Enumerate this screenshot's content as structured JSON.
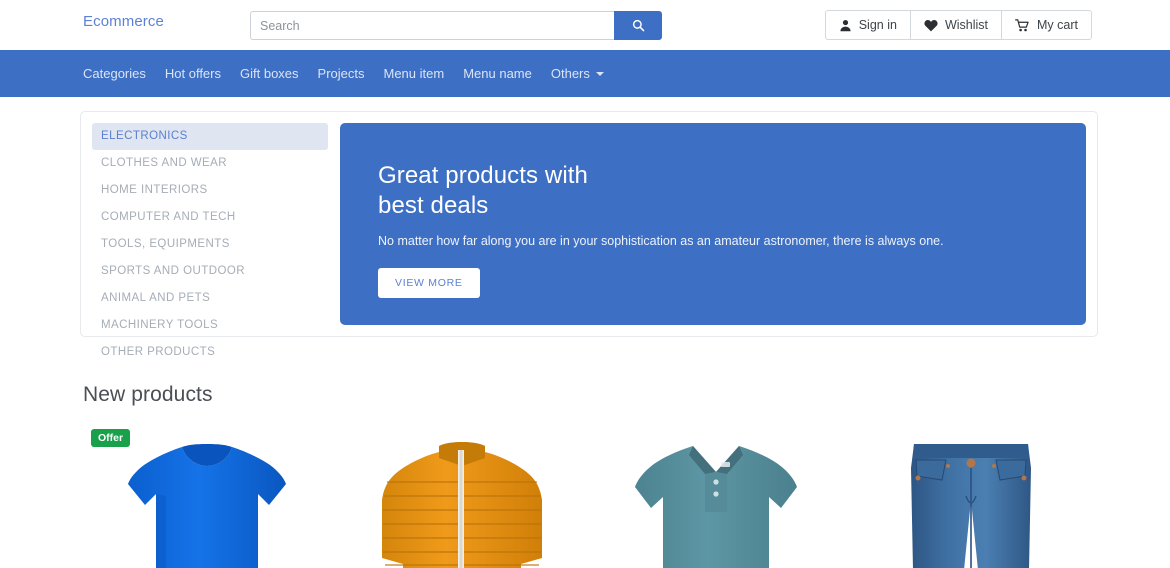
{
  "header": {
    "brand": "Ecommerce",
    "search": {
      "placeholder": "Search",
      "value": "",
      "button_icon": "search-icon"
    },
    "actions": [
      {
        "label": "Sign in",
        "icon": "user-icon"
      },
      {
        "label": "Wishlist",
        "icon": "heart-icon"
      },
      {
        "label": "My cart",
        "icon": "cart-icon"
      }
    ]
  },
  "nav": {
    "items": [
      {
        "label": "Categories",
        "has_caret": false
      },
      {
        "label": "Hot offers",
        "has_caret": false
      },
      {
        "label": "Gift boxes",
        "has_caret": false
      },
      {
        "label": "Projects",
        "has_caret": false
      },
      {
        "label": "Menu item",
        "has_caret": false
      },
      {
        "label": "Menu name",
        "has_caret": false
      },
      {
        "label": "Others",
        "has_caret": true
      }
    ]
  },
  "categories": [
    {
      "label": "ELECTRONICS",
      "active": true
    },
    {
      "label": "CLOTHES AND WEAR",
      "active": false
    },
    {
      "label": "HOME INTERIORS",
      "active": false
    },
    {
      "label": "COMPUTER AND TECH",
      "active": false
    },
    {
      "label": "TOOLS, EQUIPMENTS",
      "active": false
    },
    {
      "label": "SPORTS AND OUTDOOR",
      "active": false
    },
    {
      "label": "ANIMAL AND PETS",
      "active": false
    },
    {
      "label": "MACHINERY TOOLS",
      "active": false
    },
    {
      "label": "OTHER PRODUCTS",
      "active": false
    }
  ],
  "hero": {
    "title_line1": "Great products with",
    "title_line2": "best deals",
    "subtitle": "No matter how far along you are in your sophistication as an amateur astronomer, there is always one.",
    "cta_label": "VIEW MORE"
  },
  "new_products": {
    "title": "New products",
    "items": [
      {
        "name": "blue-t-shirt",
        "badge": "Offer"
      },
      {
        "name": "orange-puffer-jacket",
        "badge": ""
      },
      {
        "name": "teal-polo-shirt",
        "badge": ""
      },
      {
        "name": "blue-denim-jeans",
        "badge": ""
      }
    ]
  },
  "colors": {
    "primary_blue": "#3d6fc4",
    "brand_blue": "#5e80d6",
    "active_category_bg": "#dfe6f2",
    "offer_green": "#19a04b"
  }
}
